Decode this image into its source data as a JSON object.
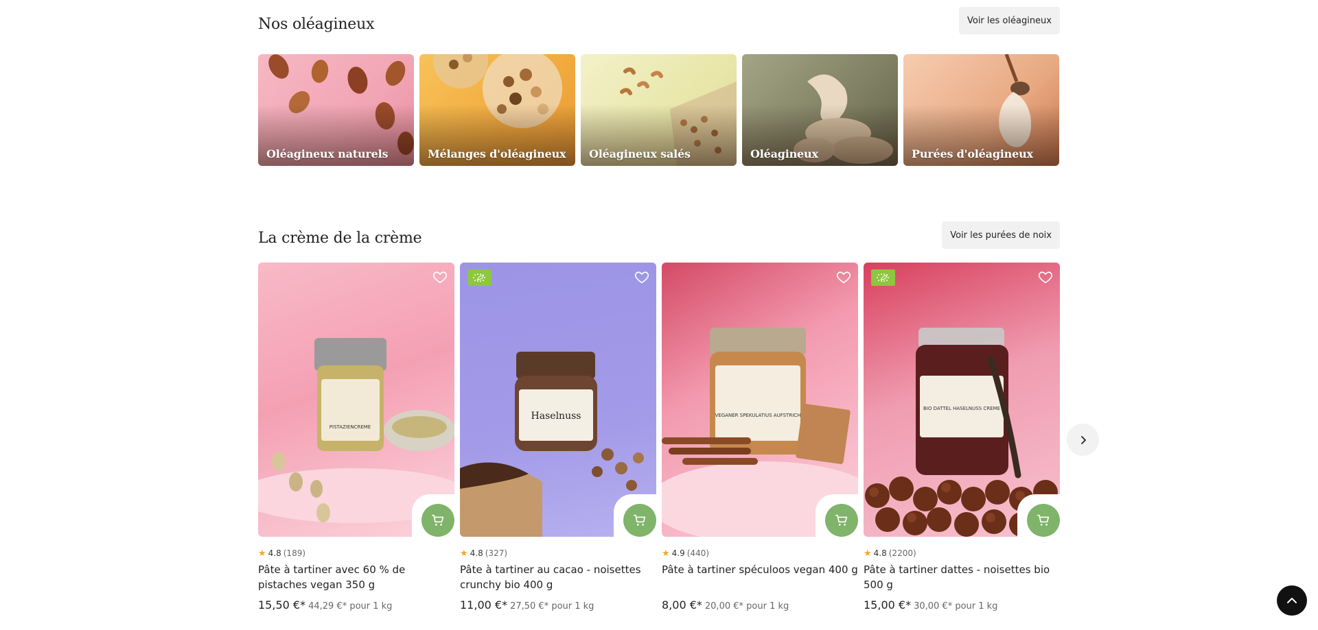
{
  "section_oleagineux": {
    "title": "Nos oléagineux",
    "button": "Voir les oléagineux",
    "categories": [
      {
        "label": "Oléagineux naturels"
      },
      {
        "label": "Mélanges d'oléagineux"
      },
      {
        "label": "Oléagineux salés"
      },
      {
        "label": "Oléagineux"
      },
      {
        "label": "Purées d'oléagineux"
      }
    ]
  },
  "section_creme": {
    "title": "La crème de la crème",
    "button": "Voir les purées de noix",
    "products": [
      {
        "rating": "4.8",
        "count": "(189)",
        "name": "Pâte à tartiner avec 60 % de pistaches vegan 350 g",
        "price": "15,50 €*",
        "unit_price": "44,29 €* pour 1 kg",
        "bio": false,
        "jar_label": "PISTAZIENCREME"
      },
      {
        "rating": "4.8",
        "count": "(327)",
        "name": "Pâte à tartiner au cacao - noisettes crunchy bio 400 g",
        "price": "11,00 €*",
        "unit_price": "27,50 €* pour 1 kg",
        "bio": true,
        "jar_label": "Haselnuss"
      },
      {
        "rating": "4.9",
        "count": "(440)",
        "name": "Pâte à tartiner spéculoos vegan 400 g",
        "price": "8,00 €*",
        "unit_price": "20,00 €* pour 1 kg",
        "bio": false,
        "jar_label": "VEGANER SPEKULATIUS AUFSTRICH"
      },
      {
        "rating": "4.8",
        "count": "(2200)",
        "name": "Pâte à tartiner dattes - noisettes bio 500 g",
        "price": "15,00 €*",
        "unit_price": "30,00 €* pour 1 kg",
        "bio": true,
        "jar_label": "BIO DATTEL HASELNUSS CREME"
      }
    ]
  },
  "colors": {
    "cart_green": "#7fb46a",
    "bio_green": "#8dc63f",
    "star": "#f5a623"
  },
  "icons": {
    "heart": "heart-icon",
    "cart": "cart-icon",
    "star": "star-icon",
    "bio_leaf": "eu-organic-leaf-icon",
    "next": "chevron-right-icon",
    "top": "chevron-up-icon"
  }
}
